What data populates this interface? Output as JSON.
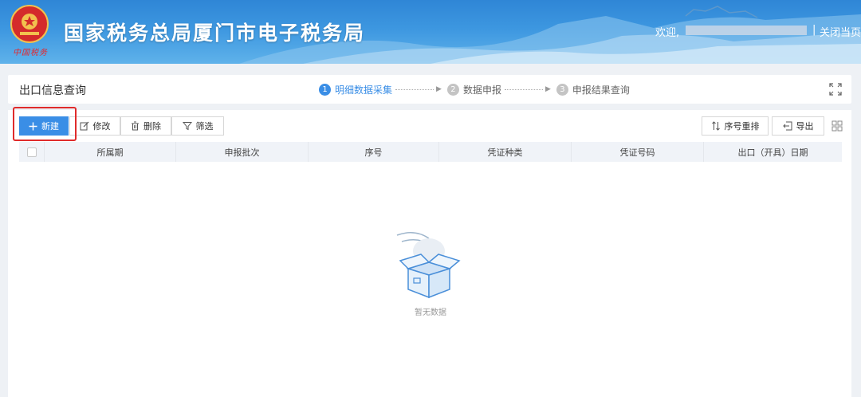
{
  "header": {
    "site_title": "国家税务总局厦门市电子税务局",
    "slogan": "中国税务",
    "welcome_label": "欢迎,",
    "separator": "|",
    "close_page_label": "关闭当页"
  },
  "titlebar": {
    "page_title": "出口信息查询",
    "steps": [
      {
        "num": "1",
        "label": "明细数据采集",
        "active": true
      },
      {
        "num": "2",
        "label": "数据申报",
        "active": false
      },
      {
        "num": "3",
        "label": "申报结果查询",
        "active": false
      }
    ],
    "step_arrow": "▶"
  },
  "toolbar": {
    "new_label": "新建",
    "edit_label": "修改",
    "delete_label": "删除",
    "filter_label": "筛选",
    "reorder_label": "序号重排",
    "export_label": "导出"
  },
  "table": {
    "columns": [
      "所属期",
      "申报批次",
      "序号",
      "凭证种类",
      "凭证号码",
      "出口（开具）日期"
    ]
  },
  "empty_state": {
    "text": "暂无数据"
  },
  "colors": {
    "primary": "#3a8ee6",
    "highlight": "#e02b2b",
    "header_bg": "#2f86d6"
  }
}
